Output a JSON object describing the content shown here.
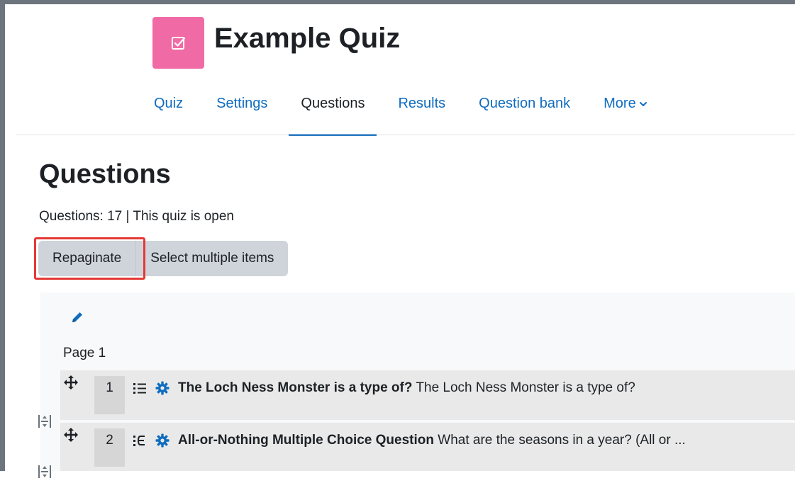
{
  "header": {
    "title": "Example Quiz",
    "icon": "quiz-checkbox-icon",
    "icon_color": "#f06ba6"
  },
  "nav": {
    "tabs": [
      {
        "label": "Quiz",
        "active": false
      },
      {
        "label": "Settings",
        "active": false
      },
      {
        "label": "Questions",
        "active": true
      },
      {
        "label": "Results",
        "active": false
      },
      {
        "label": "Question bank",
        "active": false
      }
    ],
    "more_label": "More",
    "link_color": "#0f6cbf"
  },
  "main": {
    "heading": "Questions",
    "status": "Questions: 17 | This quiz is open",
    "buttons": {
      "repaginate": "Repaginate",
      "select_multiple": "Select multiple items"
    },
    "highlight_color": "#e53935"
  },
  "section": {
    "page_label": "Page 1",
    "questions": [
      {
        "number": "1",
        "type_icon": "multichoice-list-icon",
        "name": "The Loch Ness Monster is a type of?",
        "text": "The Loch Ness Monster is a type of?"
      },
      {
        "number": "2",
        "type_icon": "all-or-nothing-icon",
        "name": "All-or-Nothing Multiple Choice Question",
        "text": "What are the seasons in a year?  (All or ..."
      }
    ]
  }
}
